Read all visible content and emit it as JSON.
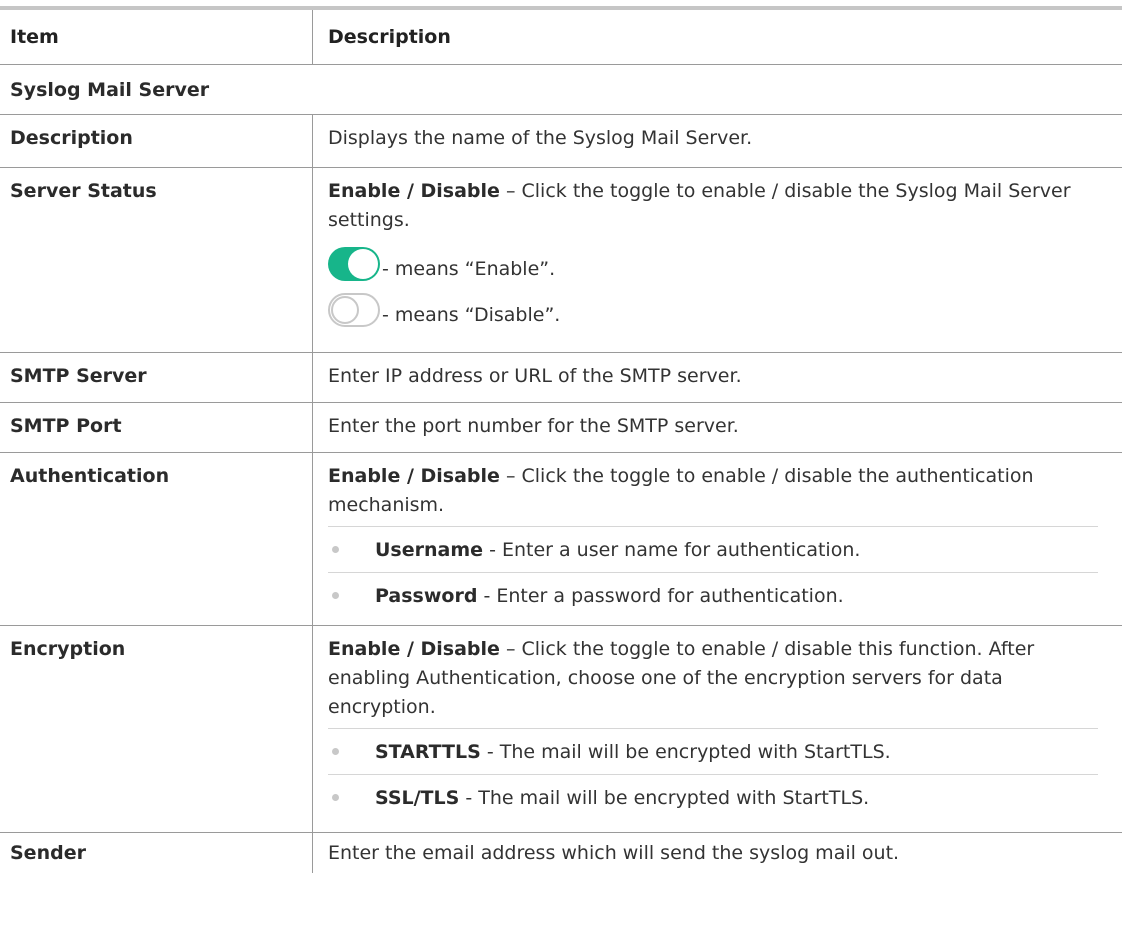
{
  "table": {
    "header": {
      "item": "Item",
      "description": "Description"
    },
    "section": "Syslog Mail Server",
    "rows": {
      "description": {
        "item": "Description",
        "text": "Displays the name of the Syslog Mail Server."
      },
      "server_status": {
        "item": "Server Status",
        "bold": "Enable / Disable",
        "text": " – Click the toggle to enable / disable the Syslog Mail Server settings.",
        "enable_text": "- means “Enable”.",
        "disable_text": "- means “Disable”.",
        "toggle_on_color": "#17b58a",
        "toggle_off_color": "#c8c8c8"
      },
      "smtp_server": {
        "item": "SMTP Server",
        "text": "Enter IP address or URL of the SMTP server."
      },
      "smtp_port": {
        "item": "SMTP Port",
        "text": "Enter the port number for the SMTP server."
      },
      "authentication": {
        "item": "Authentication",
        "bold": "Enable / Disable",
        "text": " – Click the toggle to enable / disable the authentication mechanism.",
        "bullets": [
          {
            "label": "Username",
            "text": " - Enter a user name for authentication."
          },
          {
            "label": "Password",
            "text": " - Enter a password for authentication."
          }
        ]
      },
      "encryption": {
        "item": "Encryption",
        "bold": "Enable / Disable",
        "text": " – Click the toggle to enable / disable this function. After enabling Authentication, choose one of the encryption servers for data encryption.",
        "bullets": [
          {
            "label": "STARTTLS",
            "text": " - The mail will be encrypted with StartTLS."
          },
          {
            "label": "SSL/TLS",
            "text": " - The mail will be encrypted with StartTLS."
          }
        ]
      },
      "sender": {
        "item": "Sender",
        "text": "Enter the email address which will send the syslog mail out."
      }
    }
  }
}
